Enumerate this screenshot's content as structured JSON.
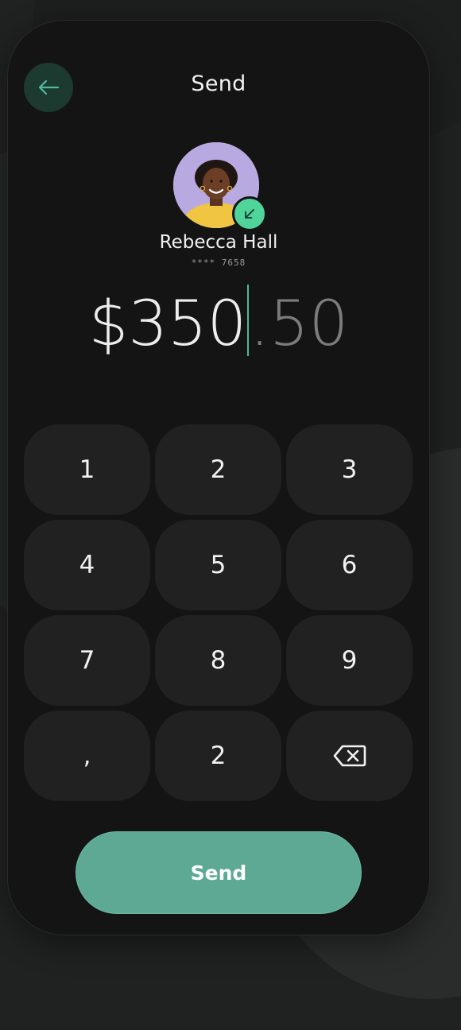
{
  "header": {
    "title": "Send",
    "back_icon": "arrow-left-icon"
  },
  "recipient": {
    "name": "Rebecca Hall",
    "card_number": "**** 7658",
    "badge_icon": "arrow-down-left-icon"
  },
  "amount": {
    "main": "$350",
    "fraction": ".50"
  },
  "keypad": {
    "keys": [
      "1",
      "2",
      "3",
      "4",
      "5",
      "6",
      "7",
      "8",
      "9",
      ",",
      "2"
    ],
    "backspace_icon": "backspace-icon"
  },
  "actions": {
    "send_label": "Send"
  },
  "colors": {
    "accent": "#5da994",
    "badge": "#4fd49a",
    "background": "#141414",
    "key": "#212121"
  }
}
